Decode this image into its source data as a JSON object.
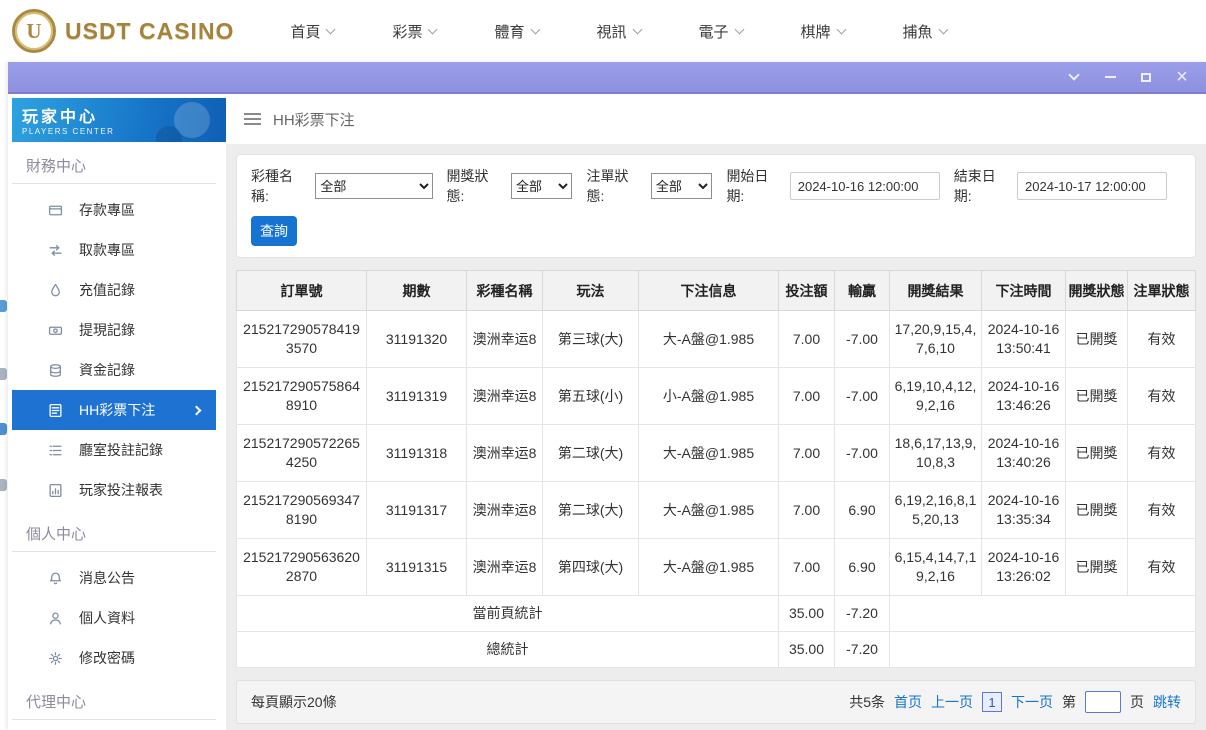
{
  "topnav": {
    "logo_badge": "U",
    "logo_text": "USDT CASINO",
    "items": [
      {
        "id": "home",
        "label": "首頁"
      },
      {
        "id": "lottery",
        "label": "彩票"
      },
      {
        "id": "sports",
        "label": "體育"
      },
      {
        "id": "video",
        "label": "視訊"
      },
      {
        "id": "electronic",
        "label": "電子"
      },
      {
        "id": "board-games",
        "label": "棋牌"
      },
      {
        "id": "fishing",
        "label": "捕魚"
      }
    ]
  },
  "sidebar": {
    "header": {
      "title": "玩家中心",
      "subtitle": "PLAYERS CENTER"
    },
    "sections": [
      {
        "label": "財務中心",
        "items": [
          {
            "id": "deposit-zone",
            "icon": "wallet",
            "label": "存款專區"
          },
          {
            "id": "withdraw-zone",
            "icon": "exchange",
            "label": "取款專區"
          },
          {
            "id": "recharge-record",
            "icon": "droplet",
            "label": "充值記錄"
          },
          {
            "id": "withdraw-record",
            "icon": "banknote",
            "label": "提現記錄"
          },
          {
            "id": "funds-record",
            "icon": "coins",
            "label": "資金記錄"
          },
          {
            "id": "hh-lottery-bets",
            "icon": "ticket",
            "label": "HH彩票下注",
            "active": true
          },
          {
            "id": "hall-bet-record",
            "icon": "list",
            "label": "廳室投註記錄"
          },
          {
            "id": "player-bet-report",
            "icon": "report",
            "label": "玩家投注報表"
          }
        ]
      },
      {
        "label": "個人中心",
        "items": [
          {
            "id": "announcements",
            "icon": "bell",
            "label": "消息公告"
          },
          {
            "id": "profile",
            "icon": "person",
            "label": "個人資料"
          },
          {
            "id": "change-password",
            "icon": "gear",
            "label": "修改密碼"
          }
        ]
      },
      {
        "label": "代理中心",
        "items": []
      }
    ]
  },
  "main": {
    "page_title": "HH彩票下注",
    "filters": {
      "lottery_label": "彩種名稱:",
      "lottery_value": "全部",
      "draw_status_label": "開獎狀態:",
      "draw_status_value": "全部",
      "order_status_label": "注單狀態:",
      "order_status_value": "全部",
      "start_label": "開始日期:",
      "start_value": "2024-10-16 12:00:00",
      "end_label": "結束日期:",
      "end_value": "2024-10-17 12:00:00",
      "search_button": "查詢"
    },
    "table": {
      "headers": [
        "訂單號",
        "期數",
        "彩種名稱",
        "玩法",
        "下注信息",
        "投注額",
        "輸贏",
        "開獎結果",
        "下注時間",
        "開獎狀態",
        "注單狀態"
      ],
      "rows": [
        {
          "order": "2152172905784193570",
          "period": "31191320",
          "lottery": "澳洲幸运8",
          "play": "第三球(大)",
          "bet_info": "大-A盤@1.985",
          "amount": "7.00",
          "winloss": "-7.00",
          "result": "17,20,9,15,4,7,6,10",
          "time": "2024-10-16 13:50:41",
          "draw_status": "已開獎",
          "order_status": "有效"
        },
        {
          "order": "2152172905758648910",
          "period": "31191319",
          "lottery": "澳洲幸运8",
          "play": "第五球(小)",
          "bet_info": "小-A盤@1.985",
          "amount": "7.00",
          "winloss": "-7.00",
          "result": "6,19,10,4,12,9,2,16",
          "time": "2024-10-16 13:46:26",
          "draw_status": "已開獎",
          "order_status": "有效"
        },
        {
          "order": "2152172905722654250",
          "period": "31191318",
          "lottery": "澳洲幸运8",
          "play": "第二球(大)",
          "bet_info": "大-A盤@1.985",
          "amount": "7.00",
          "winloss": "-7.00",
          "result": "18,6,17,13,9,10,8,3",
          "time": "2024-10-16 13:40:26",
          "draw_status": "已開獎",
          "order_status": "有效"
        },
        {
          "order": "2152172905693478190",
          "period": "31191317",
          "lottery": "澳洲幸运8",
          "play": "第二球(大)",
          "bet_info": "大-A盤@1.985",
          "amount": "7.00",
          "winloss": "6.90",
          "result": "6,19,2,16,8,15,20,13",
          "time": "2024-10-16 13:35:34",
          "draw_status": "已開獎",
          "order_status": "有效"
        },
        {
          "order": "2152172905636202870",
          "period": "31191315",
          "lottery": "澳洲幸运8",
          "play": "第四球(大)",
          "bet_info": "大-A盤@1.985",
          "amount": "7.00",
          "winloss": "6.90",
          "result": "6,15,4,14,7,19,2,16",
          "time": "2024-10-16 13:26:02",
          "draw_status": "已開獎",
          "order_status": "有效"
        }
      ],
      "summary": [
        {
          "label": "當前頁統計",
          "amount": "35.00",
          "winloss": "-7.20"
        },
        {
          "label": "總統計",
          "amount": "35.00",
          "winloss": "-7.20"
        }
      ]
    },
    "footer": {
      "page_size_text": "每頁顯示20條",
      "total_text": "共5条",
      "first": "首页",
      "prev": "上一页",
      "current": "1",
      "next": "下一页",
      "jump_prefix": "第",
      "jump_suffix": "页",
      "jump_button": "跳转"
    }
  }
}
